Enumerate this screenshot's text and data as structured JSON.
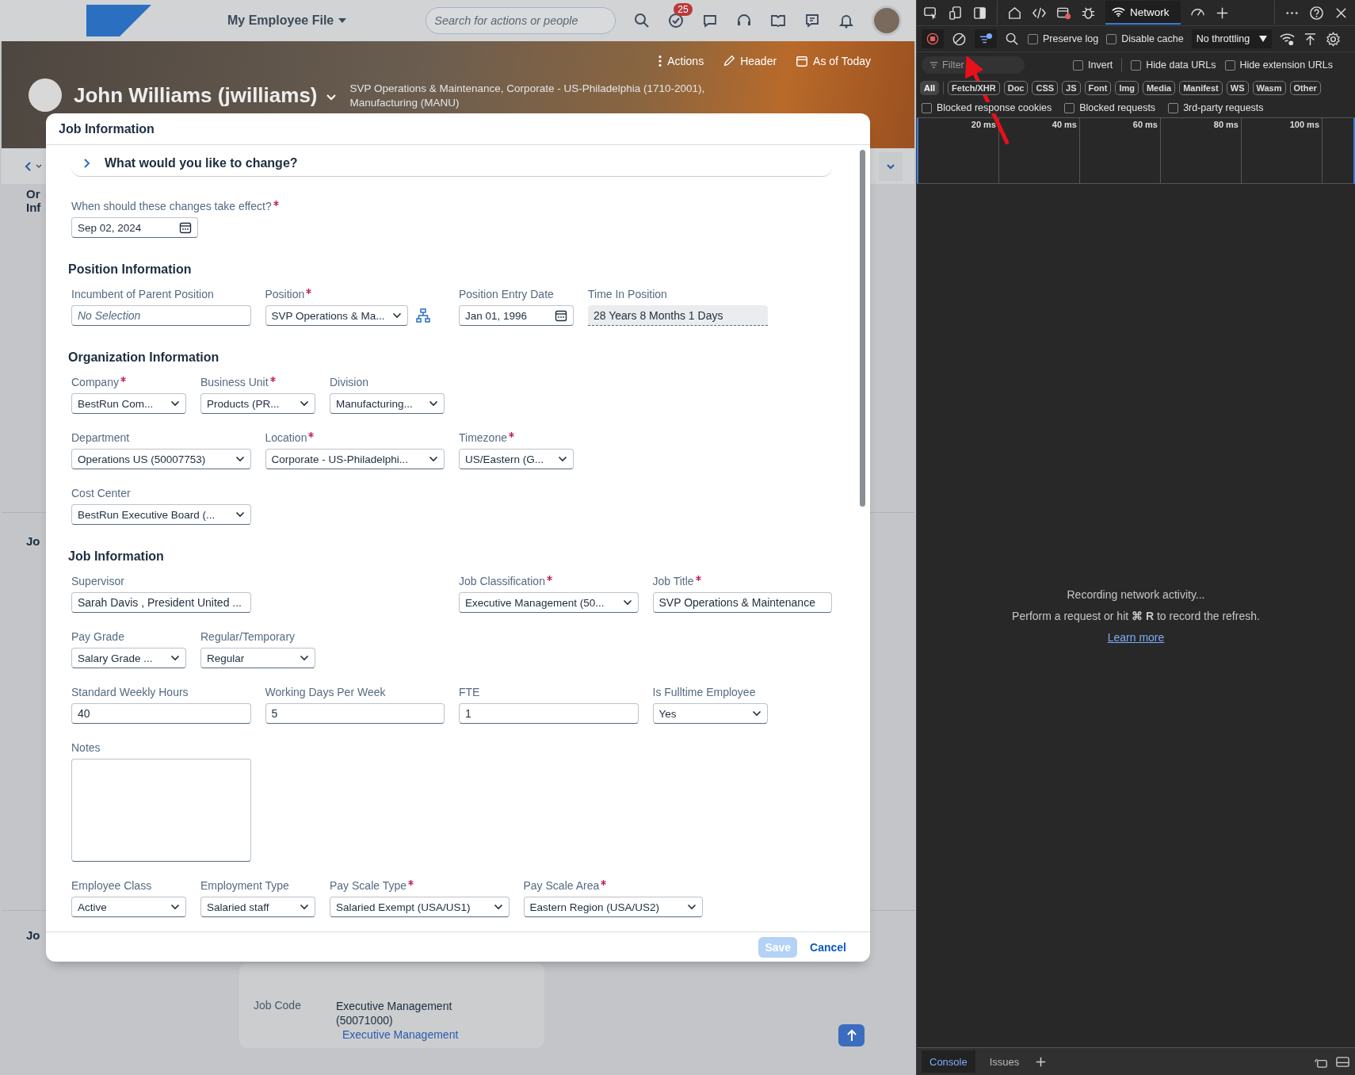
{
  "shell_header": {
    "title": "My Employee File",
    "search": {
      "placeholder": "Search for actions or people"
    },
    "task_count": "25"
  },
  "profile_header": {
    "actions": [
      "Actions",
      "Header",
      "As of Today"
    ],
    "name": "John Williams (jwilliams)",
    "subtitle_lines": [
      "SVP Operations & Maintenance, Corporate - US-Philadelphia (1710-2001),",
      "Manufacturing (MANU)"
    ]
  },
  "background_page": {
    "side_labels": [
      "Or",
      "Inf"
    ],
    "section_labels": [
      "Jo",
      "Jo"
    ],
    "job_code_card": {
      "label": "Job Code",
      "value_lines": [
        "Executive Management",
        "(50071000)"
      ],
      "link": "Executive Management"
    }
  },
  "dialog": {
    "title": "Job Information",
    "expander": {
      "label": "What would you like to change?",
      "expanded": false
    },
    "effective_date": {
      "label": "When should these changes take effect?",
      "required": true,
      "value": "Sep 02, 2024"
    },
    "sections": [
      {
        "heading": "Position Information",
        "field_groups": [
          {
            "fields": [
              {
                "label": "Incumbent of Parent Position",
                "required": false,
                "kind": "placeholder",
                "placeholder": "No Selection"
              },
              {
                "label": "Position",
                "required": true,
                "kind": "lookup",
                "value": "SVP Operations & Ma..."
              },
              {
                "label": "Position Entry Date",
                "required": false,
                "kind": "date",
                "value": "Jan 01, 1996"
              },
              {
                "label": "Time In Position",
                "required": false,
                "kind": "readonly",
                "value": "28 Years 8 Months 1 Days"
              }
            ]
          }
        ]
      },
      {
        "heading": "Organization Information",
        "field_groups": [
          {
            "fields": [
              {
                "label": "Company",
                "required": true,
                "kind": "select",
                "value": "BestRun Com..."
              },
              {
                "label": "Business Unit",
                "required": true,
                "kind": "select",
                "value": "Products (PR..."
              },
              {
                "label": "Division",
                "required": false,
                "kind": "select",
                "value": "Manufacturing..."
              }
            ]
          },
          {
            "fields": [
              {
                "label": "Department",
                "required": false,
                "kind": "select",
                "value": "Operations US (50007753)"
              },
              {
                "label": "Location",
                "required": true,
                "kind": "select",
                "value": "Corporate - US-Philadelphi..."
              },
              {
                "label": "Timezone",
                "required": true,
                "kind": "select",
                "value": "US/Eastern (G..."
              }
            ]
          },
          {
            "fields": [
              {
                "label": "Cost Center",
                "required": false,
                "kind": "select",
                "value": "BestRun Executive Board (..."
              }
            ]
          }
        ]
      },
      {
        "heading": "Job Information",
        "field_groups": [
          {
            "fields": [
              {
                "label": "Supervisor",
                "required": false,
                "kind": "input",
                "value": "Sarah Davis , President United ..."
              },
              {
                "label": "Job Classification",
                "required": true,
                "kind": "select",
                "value": "Executive Management (50..."
              },
              {
                "label": "Job Title",
                "required": true,
                "kind": "input",
                "value": "SVP Operations & Maintenance"
              }
            ]
          },
          {
            "fields": [
              {
                "label": "Pay Grade",
                "required": false,
                "kind": "select",
                "value": "Salary Grade ..."
              },
              {
                "label": "Regular/Temporary",
                "required": false,
                "kind": "select",
                "value": "Regular"
              }
            ]
          },
          {
            "fields": [
              {
                "label": "Standard Weekly Hours",
                "required": false,
                "kind": "input",
                "value": "40"
              },
              {
                "label": "Working Days Per Week",
                "required": false,
                "kind": "input",
                "value": "5"
              },
              {
                "label": "FTE",
                "required": false,
                "kind": "input",
                "value": "1"
              },
              {
                "label": "Is Fulltime Employee",
                "required": false,
                "kind": "select",
                "value": "Yes"
              }
            ]
          },
          {
            "fields": [
              {
                "label": "Notes",
                "required": false,
                "kind": "textarea"
              }
            ]
          },
          {
            "fields": [
              {
                "label": "Employee Class",
                "required": false,
                "kind": "select",
                "value": "Active"
              },
              {
                "label": "Employment Type",
                "required": false,
                "kind": "select",
                "value": "Salaried staff"
              },
              {
                "label": "Pay Scale Type",
                "required": true,
                "kind": "select",
                "value": "Salaried Exempt (USA/US1)"
              },
              {
                "label": "Pay Scale Area",
                "required": true,
                "kind": "select",
                "value": "Eastern Region (USA/US2)"
              }
            ]
          }
        ]
      }
    ],
    "buttons": [
      {
        "label": "Save",
        "disabled": true
      },
      {
        "label": "Cancel",
        "disabled": false
      }
    ]
  },
  "devtools": {
    "panel_tab": {
      "label": "Network",
      "selected": true
    },
    "toolbar": {
      "recording": true,
      "checkboxes": [
        {
          "label": "Preserve log",
          "checked": false
        },
        {
          "label": "Disable cache",
          "checked": false
        }
      ],
      "throttling": "No throttling"
    },
    "filter": {
      "placeholder": "Filter",
      "checkboxes": [
        {
          "label": "Invert",
          "checked": false
        },
        {
          "label": "Hide data URLs",
          "checked": false
        },
        {
          "label": "Hide extension URLs",
          "checked": false
        }
      ]
    },
    "type_filters": [
      {
        "label": "All",
        "selected": true
      },
      {
        "label": "Fetch/XHR",
        "selected": false
      },
      {
        "label": "Doc",
        "selected": false
      },
      {
        "label": "CSS",
        "selected": false
      },
      {
        "label": "JS",
        "selected": false
      },
      {
        "label": "Font",
        "selected": false
      },
      {
        "label": "Img",
        "selected": false
      },
      {
        "label": "Media",
        "selected": false
      },
      {
        "label": "Manifest",
        "selected": false
      },
      {
        "label": "WS",
        "selected": false
      },
      {
        "label": "Wasm",
        "selected": false
      },
      {
        "label": "Other",
        "selected": false
      }
    ],
    "request_checkboxes": [
      {
        "label": "Blocked response cookies",
        "checked": false
      },
      {
        "label": "Blocked requests",
        "checked": false
      },
      {
        "label": "3rd-party requests",
        "checked": false
      }
    ],
    "timeline_ticks": [
      "20 ms",
      "40 ms",
      "60 ms",
      "80 ms",
      "100 ms"
    ],
    "empty_state": {
      "title": "Recording network activity...",
      "hint": "Perform a request or hit **⌘ R** to record the refresh.",
      "link": "Learn more"
    },
    "drawer_tabs": [
      {
        "label": "Console",
        "selected": true
      },
      {
        "label": "Issues",
        "selected": false
      }
    ]
  }
}
